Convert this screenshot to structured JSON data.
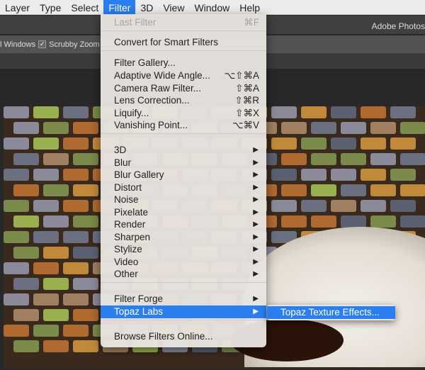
{
  "menubar": {
    "items": [
      "Layer",
      "Type",
      "Select",
      "Filter",
      "3D",
      "View",
      "Window",
      "Help"
    ],
    "active": "Filter"
  },
  "titlebar": {
    "title": "Adobe Photos"
  },
  "options": {
    "windows_label": "l Windows",
    "scrubby_zoom_label": "Scrubby Zoom",
    "scrubby_checked": true
  },
  "filter_menu": {
    "items": [
      {
        "label": "Last Filter",
        "shortcut": "⌘F",
        "disabled": true
      },
      {
        "label": "Convert for Smart Filters"
      },
      {
        "label": "Filter Gallery..."
      },
      {
        "label": "Adaptive Wide Angle...",
        "shortcut": "⌥⇧⌘A"
      },
      {
        "label": "Camera Raw Filter...",
        "shortcut": "⇧⌘A"
      },
      {
        "label": "Lens Correction...",
        "shortcut": "⇧⌘R"
      },
      {
        "label": "Liquify...",
        "shortcut": "⇧⌘X"
      },
      {
        "label": "Vanishing Point...",
        "shortcut": "⌥⌘V"
      },
      {
        "label": "3D",
        "submenu": true
      },
      {
        "label": "Blur",
        "submenu": true
      },
      {
        "label": "Blur Gallery",
        "submenu": true
      },
      {
        "label": "Distort",
        "submenu": true
      },
      {
        "label": "Noise",
        "submenu": true
      },
      {
        "label": "Pixelate",
        "submenu": true
      },
      {
        "label": "Render",
        "submenu": true
      },
      {
        "label": "Sharpen",
        "submenu": true
      },
      {
        "label": "Stylize",
        "submenu": true
      },
      {
        "label": "Video",
        "submenu": true
      },
      {
        "label": "Other",
        "submenu": true
      },
      {
        "label": "Filter Forge",
        "submenu": true
      },
      {
        "label": "Topaz Labs",
        "submenu": true,
        "selected": true
      },
      {
        "label": "Browse Filters Online..."
      }
    ]
  },
  "submenu": {
    "items": [
      "Topaz Texture Effects..."
    ]
  },
  "colors": {
    "accent": "#2a7ef0"
  }
}
